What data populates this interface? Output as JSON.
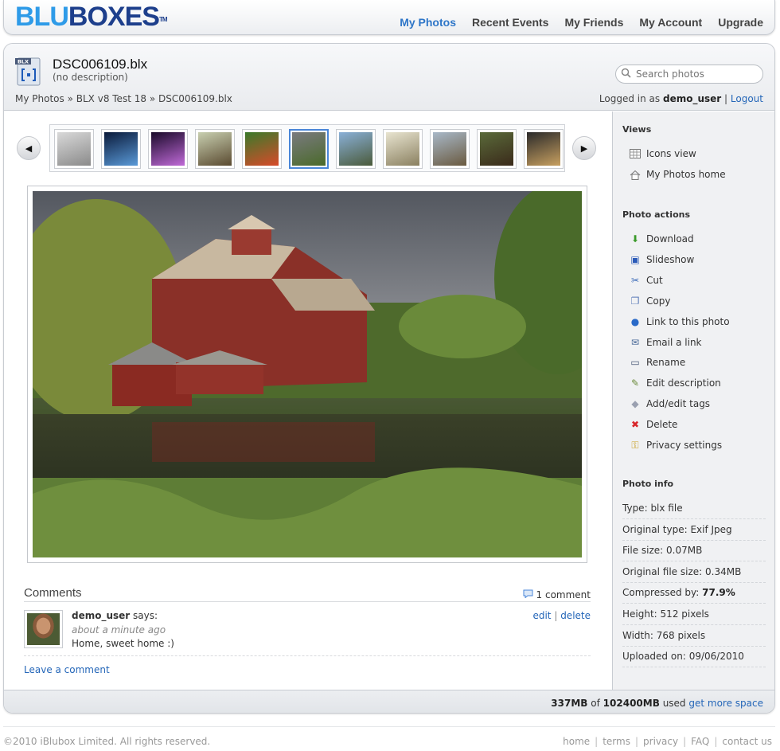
{
  "brand": {
    "part1": "BLU",
    "part2": "BOXES",
    "tm": "TM"
  },
  "nav": {
    "items": [
      {
        "label": "My Photos",
        "active": true
      },
      {
        "label": "Recent Events",
        "active": false
      },
      {
        "label": "My Friends",
        "active": false
      },
      {
        "label": "My Account",
        "active": false
      },
      {
        "label": "Upgrade",
        "active": false
      }
    ]
  },
  "file": {
    "icon_badge": "BLX",
    "title": "DSC006109.blx",
    "description": "(no description)"
  },
  "search": {
    "placeholder": "Search photos"
  },
  "breadcrumb": {
    "items": [
      "My Photos",
      "BLX v8 Test 18",
      "DSC006109.blx"
    ],
    "separator": "»"
  },
  "session": {
    "prefix": "Logged in as",
    "user": "demo_user",
    "sep": "|",
    "logout": "Logout"
  },
  "thumbnails": [
    {
      "name": "corridor",
      "selected": false,
      "colors": [
        "#d9d9d9",
        "#8a8a8a"
      ]
    },
    {
      "name": "earth",
      "selected": false,
      "colors": [
        "#0a1a3a",
        "#5a9ad8"
      ]
    },
    {
      "name": "purple-flare",
      "selected": false,
      "colors": [
        "#1a0a2a",
        "#c06ad8"
      ]
    },
    {
      "name": "cabin",
      "selected": false,
      "colors": [
        "#c8cfb0",
        "#5a4a30"
      ]
    },
    {
      "name": "parrots",
      "selected": false,
      "colors": [
        "#3a7a2a",
        "#d84a2a"
      ]
    },
    {
      "name": "barn",
      "selected": true,
      "colors": [
        "#7a7a80",
        "#4a6a2a"
      ]
    },
    {
      "name": "lighthouse",
      "selected": false,
      "colors": [
        "#8ab0d8",
        "#4a5a3a"
      ]
    },
    {
      "name": "airplane",
      "selected": false,
      "colors": [
        "#e8e4d0",
        "#8a8060"
      ]
    },
    {
      "name": "lighthouse-2",
      "selected": false,
      "colors": [
        "#a8b8c8",
        "#6a5a40"
      ]
    },
    {
      "name": "portrait",
      "selected": false,
      "colors": [
        "#5a6a3a",
        "#3a2a1a"
      ]
    },
    {
      "name": "still-life",
      "selected": false,
      "colors": [
        "#2a2a2a",
        "#c8a060"
      ]
    }
  ],
  "comments": {
    "title": "Comments",
    "count_label": "1 comment",
    "items": [
      {
        "user": "demo_user",
        "says": "says:",
        "time": "about a minute ago",
        "text": "Home, sweet home :)",
        "edit": "edit",
        "sep": "|",
        "delete": "delete"
      }
    ],
    "leave": "Leave a comment"
  },
  "sidebar": {
    "views_title": "Views",
    "views": [
      {
        "label": "Icons view",
        "icon": "grid-icon"
      },
      {
        "label": "My Photos home",
        "icon": "home-icon"
      }
    ],
    "actions_title": "Photo actions",
    "actions": [
      {
        "label": "Download",
        "icon": "download-icon",
        "glyph": "⬇",
        "color": "#3a9a2a"
      },
      {
        "label": "Slideshow",
        "icon": "slideshow-icon",
        "glyph": "▣",
        "color": "#2a5ab8"
      },
      {
        "label": "Cut",
        "icon": "scissors-icon",
        "glyph": "✂",
        "color": "#3a6ab8"
      },
      {
        "label": "Copy",
        "icon": "copy-icon",
        "glyph": "❐",
        "color": "#5a7ab8"
      },
      {
        "label": "Link to this photo",
        "icon": "link-icon",
        "glyph": "●",
        "color": "#2a6ac8"
      },
      {
        "label": "Email a link",
        "icon": "email-icon",
        "glyph": "✉",
        "color": "#4a6a98"
      },
      {
        "label": "Rename",
        "icon": "rename-icon",
        "glyph": "▭",
        "color": "#4a5a78"
      },
      {
        "label": "Edit description",
        "icon": "edit-description-icon",
        "glyph": "✎",
        "color": "#6a8a3a"
      },
      {
        "label": "Add/edit tags",
        "icon": "tag-icon",
        "glyph": "◆",
        "color": "#9aa0b0"
      },
      {
        "label": "Delete",
        "icon": "delete-icon",
        "glyph": "✖",
        "color": "#d8262a"
      },
      {
        "label": "Privacy settings",
        "icon": "privacy-key-icon",
        "glyph": "⚿",
        "color": "#c8a020"
      }
    ],
    "info_title": "Photo info",
    "info": [
      {
        "label": "Type:",
        "value": "blx file",
        "bold": false
      },
      {
        "label": "Original type:",
        "value": "Exif Jpeg",
        "bold": false
      },
      {
        "label": "File size:",
        "value": "0.07MB",
        "bold": false
      },
      {
        "label": "Original file size:",
        "value": "0.34MB",
        "bold": false
      },
      {
        "label": "Compressed by:",
        "value": "77.9%",
        "bold": true
      },
      {
        "label": "Height:",
        "value": "512 pixels",
        "bold": false
      },
      {
        "label": "Width:",
        "value": "768 pixels",
        "bold": false
      },
      {
        "label": "Uploaded on:",
        "value": "09/06/2010",
        "bold": false
      }
    ]
  },
  "storage": {
    "used": "337MB",
    "of": "of",
    "total": "102400MB",
    "used_label": "used",
    "more": "get more space"
  },
  "footer": {
    "copyright": "©2010 iBlubox Limited. All rights reserved.",
    "links": [
      "home",
      "terms",
      "privacy",
      "FAQ",
      "contact us"
    ],
    "sep": "|"
  },
  "colors": {
    "accent": "#2e76c8",
    "brand_light": "#2e9be8",
    "brand_dark": "#1d3f8c",
    "link": "#2466b8"
  }
}
